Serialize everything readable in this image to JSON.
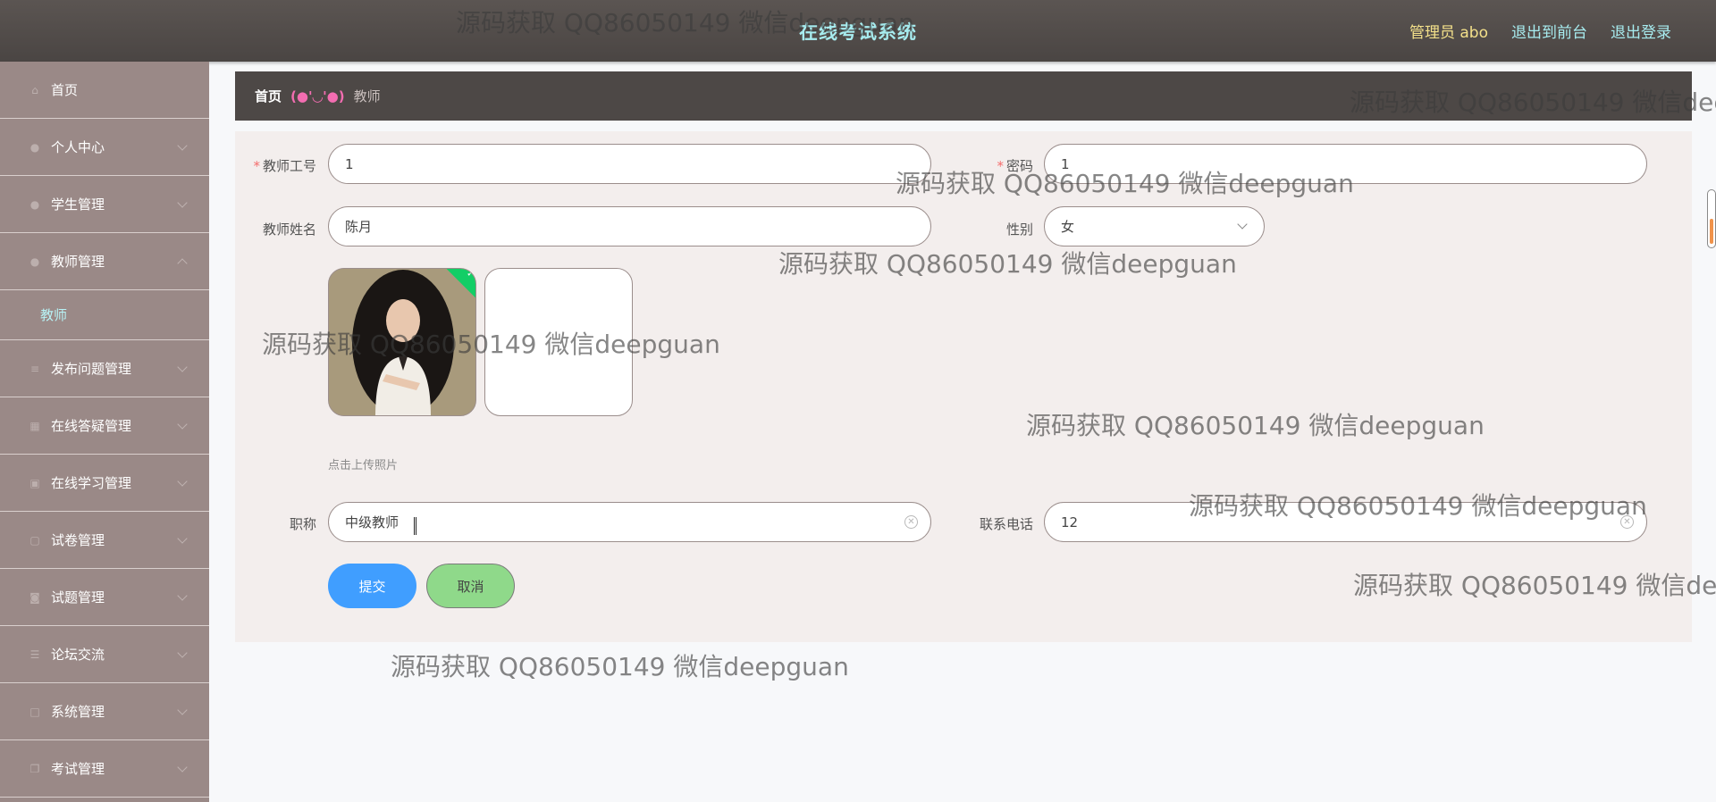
{
  "header": {
    "title": "在线考试系统",
    "admin_label": "管理员 abo",
    "to_frontend": "退出到前台",
    "logout": "退出登录"
  },
  "sidebar": {
    "items": [
      {
        "label": "首页",
        "icon": "home-icon"
      },
      {
        "label": "个人中心",
        "icon": "user-icon"
      },
      {
        "label": "学生管理",
        "icon": "user-icon"
      },
      {
        "label": "教师管理",
        "icon": "user-icon"
      },
      {
        "label": "发布问题管理",
        "icon": "list-icon"
      },
      {
        "label": "在线答疑管理",
        "icon": "grid-icon"
      },
      {
        "label": "在线学习管理",
        "icon": "calendar-icon"
      },
      {
        "label": "试卷管理",
        "icon": "doc-icon"
      },
      {
        "label": "试题管理",
        "icon": "camera-icon"
      },
      {
        "label": "论坛交流",
        "icon": "menu-icon"
      },
      {
        "label": "系统管理",
        "icon": "square-icon"
      },
      {
        "label": "考试管理",
        "icon": "copy-icon"
      }
    ],
    "sub_teacher": "教师"
  },
  "breadcrumb": {
    "home": "首页",
    "separator": "(●'◡'●)",
    "current": "教师"
  },
  "form": {
    "teacher_id_label": "教师工号",
    "teacher_id_value": "1",
    "password_label": "密码",
    "password_value": "1",
    "name_label": "教师姓名",
    "name_value": "陈月",
    "gender_label": "性别",
    "gender_value": "女",
    "upload_hint": "点击上传照片",
    "title_label": "职称",
    "title_value": "中级教师",
    "phone_label": "联系电话",
    "phone_value": "12",
    "submit": "提交",
    "cancel": "取消"
  },
  "watermark_text": "源码获取 QQ86050149 微信deepguan",
  "colors": {
    "header_bg": "#4f4a48",
    "sidebar_bg": "#9a8987",
    "title_color": "#a7ecef",
    "submit_bg": "#409eff",
    "cancel_bg": "#8fd98a"
  }
}
